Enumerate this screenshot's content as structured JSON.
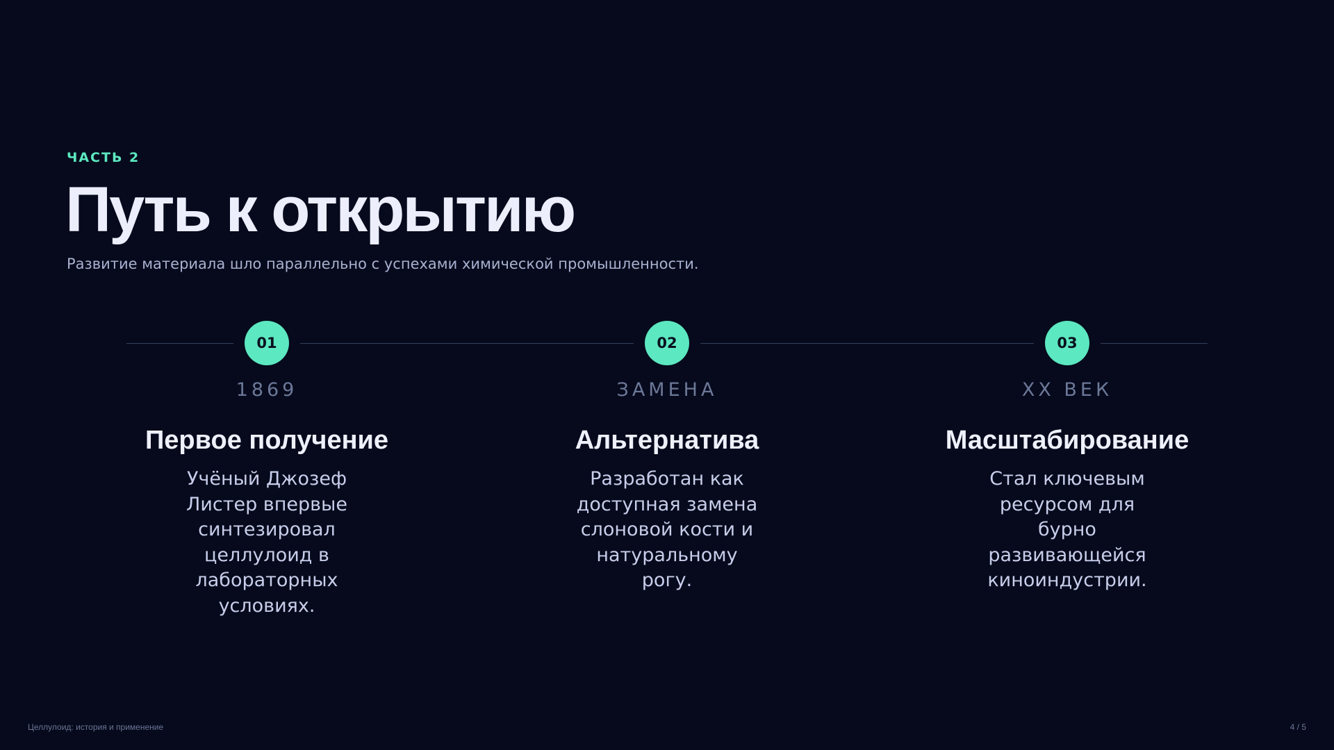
{
  "header": {
    "kicker": "ЧАСТЬ 2",
    "title": "Путь к открытию",
    "subtitle": "Развитие материала шло параллельно с успехами химической промышленности."
  },
  "timeline": {
    "steps": [
      {
        "number": "01",
        "label": "1869",
        "heading": "Первое получение",
        "text": "Учёный Джозеф Листер впервые синтезировал целлулоид в лабораторных условиях."
      },
      {
        "number": "02",
        "label": "ЗАМЕНА",
        "heading": "Альтернатива",
        "text": "Разработан как доступная замена слоновой кости и натуральному рогу."
      },
      {
        "number": "03",
        "label": "XX ВЕК",
        "heading": "Масштабирование",
        "text": "Стал ключевым ресурсом для бурно развивающейся киноиндустрии."
      }
    ]
  },
  "footer": {
    "presentation_title": "Целлулоид: история и применение",
    "page_indicator": "4 / 5"
  },
  "colors": {
    "background": "#060a1c",
    "accent": "#5ce8c0",
    "title": "#eceefc",
    "muted": "#6c7898"
  }
}
